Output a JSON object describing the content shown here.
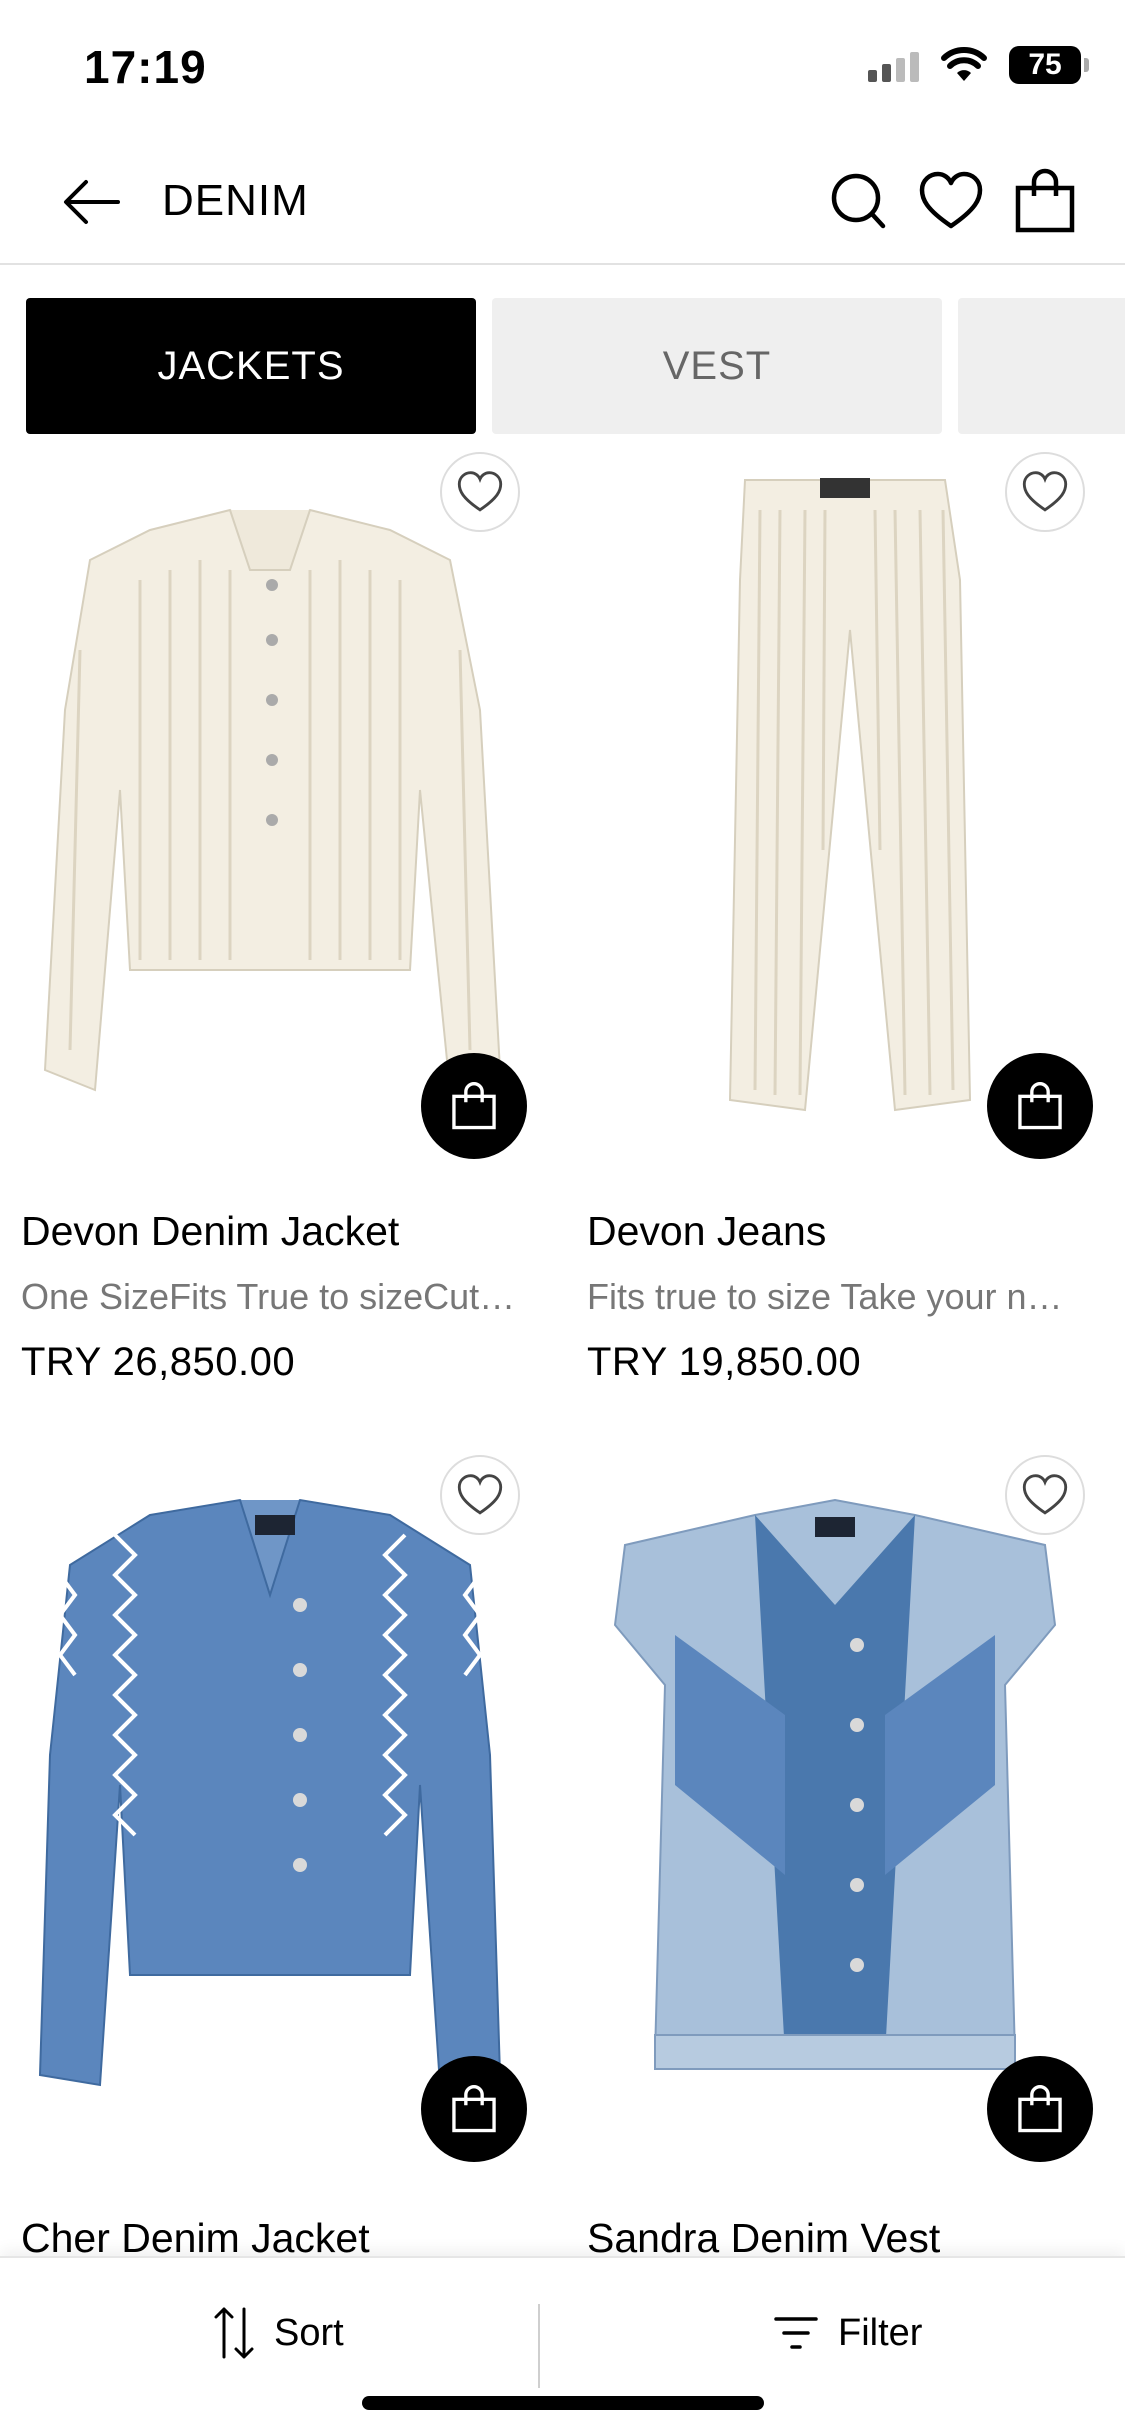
{
  "status_bar": {
    "time": "17:19",
    "battery": "75"
  },
  "nav": {
    "title": "DENIM"
  },
  "tabs": [
    {
      "label": "JACKETS",
      "active": true
    },
    {
      "label": "VEST",
      "active": false
    },
    {
      "label": "",
      "active": false
    }
  ],
  "products": [
    {
      "name": "Devon Denim Jacket",
      "description": "One SizeFits True to sizeCut…",
      "price": "TRY 26,850.00"
    },
    {
      "name": "Devon Jeans",
      "description": "Fits true to size Take your n…",
      "price": "TRY 19,850.00"
    },
    {
      "name": "Cher Denim Jacket",
      "description": "",
      "price": ""
    },
    {
      "name": "Sandra Denim Vest",
      "description": "",
      "price": ""
    }
  ],
  "bottom_bar": {
    "sort_label": "Sort",
    "filter_label": "Filter"
  },
  "icons": [
    "back-arrow-icon",
    "search-icon",
    "heart-icon",
    "shopping-bag-icon",
    "sort-icon",
    "filter-icon"
  ],
  "colors": {
    "accent": "#000000",
    "tab_inactive_bg": "#efefef",
    "muted_text": "#777777"
  }
}
